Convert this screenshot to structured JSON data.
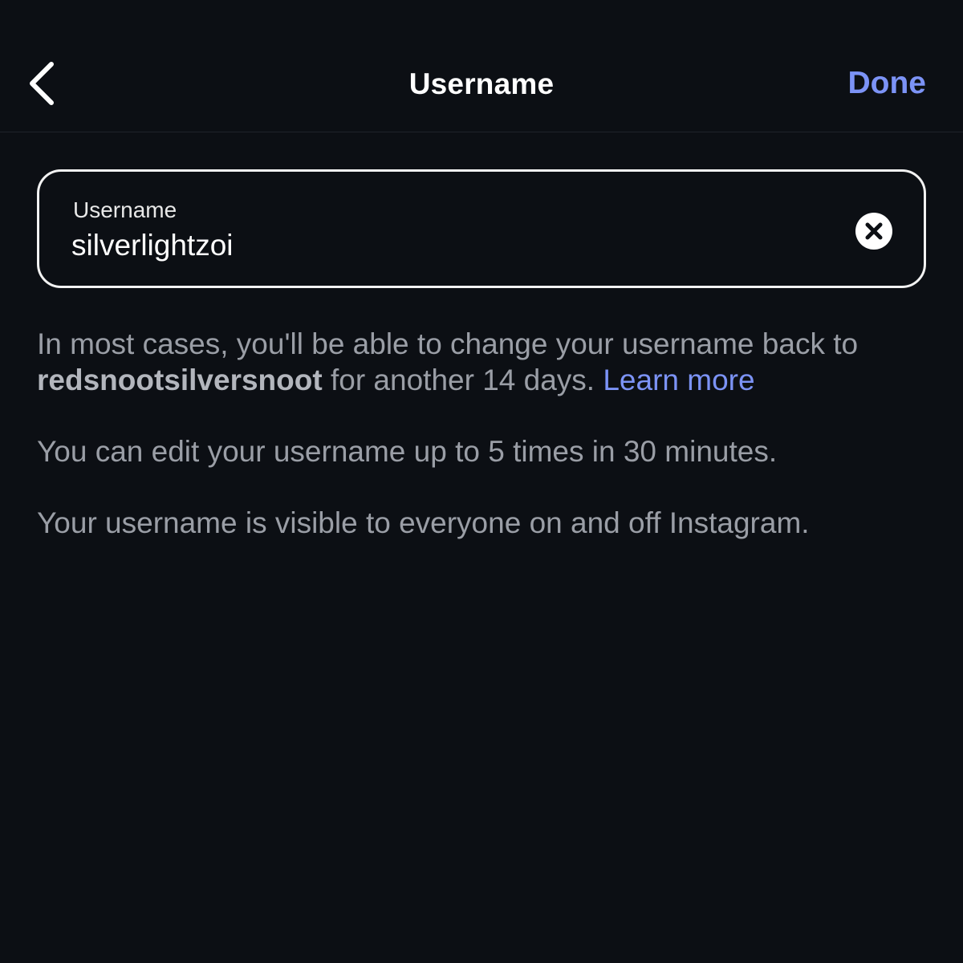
{
  "header": {
    "title": "Username",
    "done_label": "Done",
    "back_icon": "chevron-left-icon"
  },
  "field": {
    "label": "Username",
    "value": "silverlightzoi",
    "clear_icon": "clear-circle-x-icon"
  },
  "info": {
    "line1_prefix": "In most cases, you'll be able to change your username back to ",
    "previous_username": "redsnootsilversnoot",
    "line1_suffix": " for another 14 days. ",
    "learn_more": "Learn more",
    "line2": "You can edit your username up to 5 times in 30 minutes.",
    "line3": "Your username is visible to everyone on and off Instagram."
  },
  "colors": {
    "background": "#0c0f14",
    "accent": "#7c93f6",
    "secondary_text": "#9a9ea6",
    "field_border": "#f2f2f2"
  }
}
